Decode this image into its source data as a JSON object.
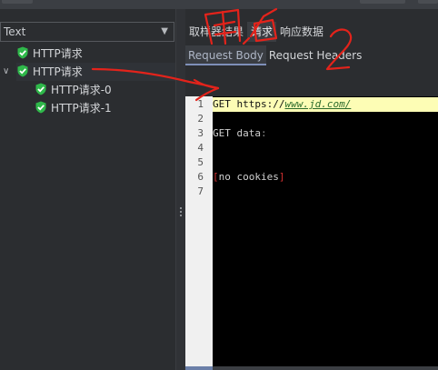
{
  "left": {
    "filter": {
      "value": "Text",
      "icon": "chevron-down-icon"
    },
    "tree": [
      {
        "label": "HTTP请求",
        "icon": "shield-check-icon"
      },
      {
        "label": "HTTP请求",
        "icon": "shield-check-icon",
        "expanded": true
      },
      {
        "label": "HTTP请求-0",
        "icon": "shield-check-icon"
      },
      {
        "label": "HTTP请求-1",
        "icon": "shield-check-icon"
      }
    ],
    "expander": "∨"
  },
  "right": {
    "tabs": [
      "取样器结果",
      "请求",
      "响应数据"
    ],
    "subtabs": [
      "Request Body",
      "Request Headers"
    ],
    "editor": {
      "line_numbers": [
        "1",
        "2",
        "3",
        "4",
        "5",
        "6",
        "7"
      ],
      "line1": {
        "prefix": "GET https://",
        "url": "www.jd.com/"
      },
      "line3": {
        "text": "GET data",
        "colon": ":"
      },
      "line6": {
        "open": "[",
        "text": "no cookies",
        "close": "]"
      }
    }
  },
  "colors": {
    "background": "#2b2d30",
    "shield_green": "#2fb84a",
    "highlight_line": "#fdfdb5",
    "annotation_red": "#e3231b"
  }
}
